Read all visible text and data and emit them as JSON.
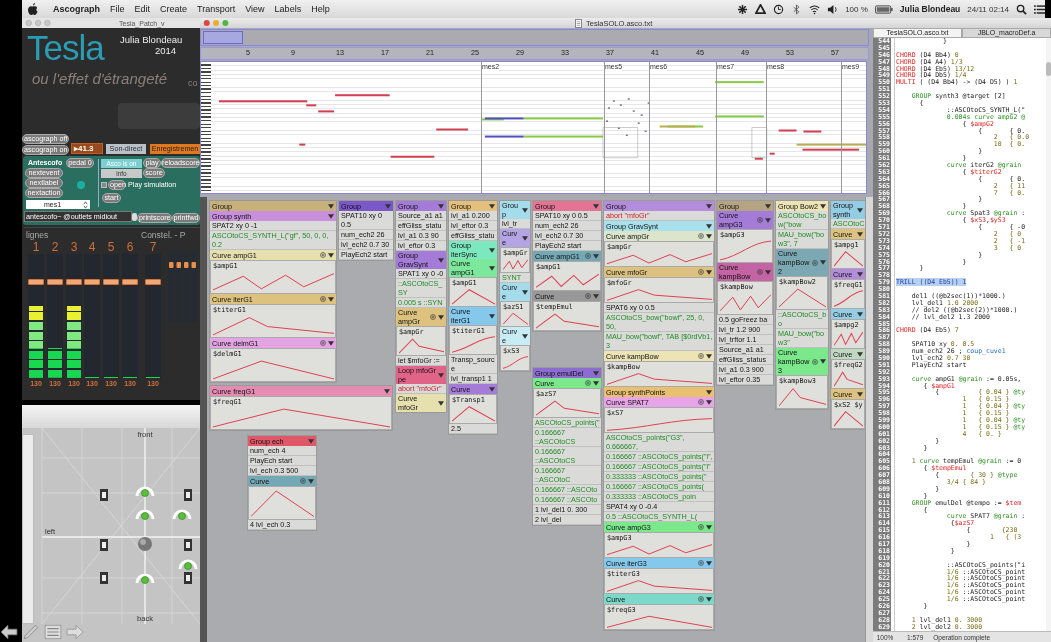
{
  "menu_bar": {
    "app": "Ascograph",
    "items": [
      "File",
      "Edit",
      "Create",
      "Transport",
      "View",
      "Labels",
      "Help"
    ],
    "battery": "100 %",
    "user": "Julia Blondeau",
    "clock": "24/11 02:14"
  },
  "patch": {
    "title": "Tesla_Patch_v",
    "author": "Julia Blondeau",
    "year": "2014",
    "heading": "Tesla",
    "subtitle": "ou l'effet d'étrangeté",
    "cut_text": "co",
    "graph_toggles": [
      "ascograph off",
      "ascograph on"
    ],
    "number_box": "▸41.3",
    "modes": [
      {
        "label": "Son-direct",
        "selected": false
      },
      {
        "label": "Enregistremen",
        "selected": true
      }
    ],
    "antescofo": {
      "title": "Antescofo",
      "pedal": "pedal 0",
      "messages": [
        "nextevent",
        "nextlabel",
        "nextaction"
      ],
      "status": "Asco is on",
      "info": "info",
      "play": "play",
      "score": "score",
      "reload": "reloadscore",
      "sim_toggle": {
        "checked": false
      },
      "open": "open",
      "simulation": "Play simulation",
      "start": "start",
      "menu": "mes1",
      "object": "antescofo~ @outlets midiout",
      "printscore": "printscore",
      "printfwd": "printfwd"
    },
    "mixer": {
      "title": "lignes",
      "right_title": "Constel. - P",
      "channels": [
        {
          "name": "1",
          "meter": {
            "level": 0.58
          },
          "fader": {
            "level": 0.8
          },
          "value": "130"
        },
        {
          "name": "2",
          "meter": {
            "level": 0.24
          },
          "fader": {
            "level": 0.8
          },
          "value": "130"
        },
        {
          "name": "3",
          "meter": {
            "level": 0.58
          },
          "fader": {
            "level": 0.8
          },
          "value": "130"
        },
        {
          "name": "4",
          "meter": {
            "level": 0
          },
          "fader": {
            "level": 0.8
          },
          "value": "130"
        },
        {
          "name": "5",
          "meter": {
            "level": 0
          },
          "fader": {
            "level": 0.8
          },
          "value": "130"
        },
        {
          "name": "6",
          "meter": {
            "level": 0
          },
          "fader": {
            "level": 0.8
          },
          "value": "130"
        },
        {
          "name": "7",
          "meter": {
            "level": 0
          },
          "fader": {
            "level": 0.8
          },
          "value": "130"
        }
      ]
    }
  },
  "spatial": {
    "front": "front",
    "left": "left",
    "back": "back"
  },
  "ascograph": {
    "title": "TeslaSOLO.asco.txt",
    "ruler": [
      "5",
      "9",
      "13",
      "17",
      "21",
      "25",
      "29",
      "33",
      "37",
      "41",
      "45",
      "49",
      "53",
      "57"
    ],
    "measures": [
      "mes2",
      "mes5",
      "mes6",
      "mes7",
      "mes8",
      "mes9"
    ],
    "nodes": [
      {
        "title": "Group",
        "color": "#c8b07a",
        "items": [
          {
            "kind": "header",
            "label": "Group synth",
            "color": "#c890dc"
          },
          {
            "kind": "row",
            "text": "SPAT2 xy 0 -1"
          },
          {
            "kind": "code",
            "text": "ASCOtoCS_SYNTH_L(\"gf\", 50, 0, 0, 0.2"
          },
          {
            "kind": "curve",
            "label": "Curve ampG1",
            "color": "#e6dfae",
            "var": "$ampG1"
          },
          {
            "kind": "curve",
            "label": "Curve iterG1",
            "color": "#dcc27e",
            "var": "$titerG1"
          },
          {
            "kind": "curve",
            "label": "Curve delmG1",
            "color": "#e4a4e4",
            "var": "$delmG1"
          }
        ]
      },
      {
        "title": "Curve freqG1",
        "color": "#e48cb4",
        "items": [
          {
            "kind": "plot",
            "var": "$freqG1"
          }
        ]
      },
      {
        "title": "Group ech",
        "color": "#e05868",
        "items": [
          {
            "kind": "row",
            "text": "num_ech 4"
          },
          {
            "kind": "row",
            "text": "PlayEch start"
          },
          {
            "kind": "row",
            "text": "lvl_ech 0.3 500"
          },
          {
            "kind": "curve",
            "label": "Curve",
            "color": "#74a8b4"
          },
          {
            "kind": "row",
            "text": "4 lvl_ech 0.3"
          }
        ]
      },
      {
        "title": "Group",
        "color": "#7a58c8",
        "items": [
          {
            "kind": "row",
            "text": "SPAT10 xy 0 0.5"
          },
          {
            "kind": "row",
            "text": "num_ech2 26"
          },
          {
            "kind": "row",
            "text": "lvl_ech2 0.7 30"
          },
          {
            "kind": "row",
            "text": "PlayEch2 start"
          }
        ]
      },
      {
        "title": "Group",
        "color": "#a47cd8",
        "items": [
          {
            "kind": "row",
            "text": "Source_a1 a1"
          },
          {
            "kind": "row",
            "text": "effGliss_statu"
          },
          {
            "kind": "row",
            "text": "lvl_a1 0.3 90"
          },
          {
            "kind": "row",
            "text": "lvl_eftor 0.3"
          },
          {
            "kind": "header",
            "label": "Group GravSynt",
            "color": "#a47cd8"
          },
          {
            "kind": "row",
            "text": "SPAT1 xy 0 -0"
          },
          {
            "kind": "code",
            "text": "::ASCOtoCS_SY"
          },
          {
            "kind": "code",
            "text": "0.005 s ::SYN"
          },
          {
            "kind": "curve",
            "label": "Curve ampGr",
            "color": "#dcc27e",
            "var": "$ampGr"
          },
          {
            "kind": "row",
            "text": "let $mfoGr :="
          },
          {
            "kind": "header",
            "label": "Loop mfoGr pe",
            "color": "#e06488"
          },
          {
            "kind": "abort",
            "text": "abort \"mfoGr\""
          },
          {
            "kind": "header",
            "label": "Curve mfoGr",
            "color": "#e6dfae"
          }
        ]
      },
      {
        "title": "Group",
        "color": "#e4c07c",
        "items": [
          {
            "kind": "row",
            "text": "lvl_a1 0.200"
          },
          {
            "kind": "row",
            "text": "lvl_eftor 0.3"
          },
          {
            "kind": "row",
            "text": "effGliss_statu"
          },
          {
            "kind": "header",
            "label": "Group iterSync",
            "color": "#7ce8c0"
          },
          {
            "kind": "curve",
            "label": "Curve ampG1",
            "color": "#7ce89c",
            "var": "$ampG1"
          },
          {
            "kind": "curve",
            "label": "Curve iterG1",
            "color": "#84c8ec",
            "var": "$titerG1"
          },
          {
            "kind": "row",
            "text": "Transp_source"
          },
          {
            "kind": "row",
            "text": "lvl_transp1 1"
          },
          {
            "kind": "curve",
            "label": "Curve",
            "color": "#a47cd8",
            "var": "$Transp1"
          },
          {
            "kind": "row",
            "text": "2.5"
          }
        ]
      },
      {
        "title": "Group",
        "color": "#a4dcec",
        "items": [
          {
            "kind": "row",
            "text": "lvl_tr"
          },
          {
            "kind": "curve",
            "label": "Curve",
            "color": "#b4a4e4",
            "var": "$ampGr"
          },
          {
            "kind": "code",
            "text": "SYNT"
          },
          {
            "kind": "curve",
            "label": "Curve",
            "color": "#a4dcec",
            "var": "$azS1"
          },
          {
            "kind": "curve",
            "label": "Curve",
            "color": "#c8ecf4",
            "var": "$xS3"
          }
        ]
      },
      {
        "title": "Group",
        "color": "#e47494",
        "items": [
          {
            "kind": "row",
            "text": "SPAT10 xy 0 0.5"
          },
          {
            "kind": "row",
            "text": "num_ech2 26"
          },
          {
            "kind": "row",
            "text": "lvl_ech2 0.7 30"
          },
          {
            "kind": "row",
            "text": "PlayEch2 start"
          },
          {
            "kind": "curve",
            "label": "Curve ampG1",
            "color": "#74a8b4",
            "var": "$ampG1"
          },
          {
            "kind": "curve",
            "label": "Curve",
            "color": "#989898",
            "var": "$tempEmul"
          }
        ]
      },
      {
        "title": "Group emulDel",
        "color": "#8c6cd0",
        "items": [
          {
            "kind": "curve",
            "label": "Curve",
            "color": "#7ce88c",
            "var": "$azS7"
          },
          {
            "kind": "code",
            "text": "ASCOtoCS_points(\""
          },
          {
            "kind": "code",
            "text": "0.166667 ::ASCOtoCS"
          },
          {
            "kind": "code",
            "text": "0.166667 ::ASCOtoCS"
          },
          {
            "kind": "code",
            "text": "0.166667 ::ASCOtoC"
          },
          {
            "kind": "code",
            "text": "0.166667 ::ASCOto"
          },
          {
            "kind": "code",
            "text": "0.166667 ::ASCOto"
          },
          {
            "kind": "row",
            "text": "1 lvl_del1 0. 300"
          },
          {
            "kind": "row",
            "text": "2 lvl_del"
          }
        ]
      },
      {
        "title": "Group",
        "color": "#b48cdc",
        "items": [
          {
            "kind": "abort",
            "text": "abort \"mfoGr\""
          },
          {
            "kind": "header",
            "label": "Group GravSynt",
            "color": "#a8e0ec"
          },
          {
            "kind": "curve",
            "label": "Curve ampGr",
            "color": "#dce4cc",
            "var": "$ampGr"
          },
          {
            "kind": "curve",
            "label": "Curve mfoGr",
            "color": "#dcc27e",
            "var": "$mfoGr"
          },
          {
            "kind": "row",
            "text": "SPAT6 xy 0 0.5"
          },
          {
            "kind": "code",
            "text": "ASCOtoCS_bow(\"bowf\", 25, 0, 50,"
          },
          {
            "kind": "code",
            "text": "MAU_bow(\"bowf\", TAB [$0rdVb1, 3"
          },
          {
            "kind": "curve",
            "label": "Curve kampBow",
            "color": "#ece4b4",
            "var": "$kampBow"
          },
          {
            "kind": "header",
            "label": "Group synthPoints",
            "color": "#e8c070"
          },
          {
            "kind": "curve",
            "label": "Curve SPAT7",
            "color": "#e8a4e8",
            "var": "$xS7"
          },
          {
            "kind": "code",
            "text": "ASCOtoCS_points(\"G3\", 0.666667,"
          },
          {
            "kind": "code",
            "text": "0.166667 ::ASCOtoCS_points(\"i\","
          },
          {
            "kind": "code",
            "text": "0.166667 ::ASCOtoCS_points(\"i\""
          },
          {
            "kind": "code",
            "text": "0.333333 ::ASCOtoCS_points(\""
          },
          {
            "kind": "code",
            "text": "0.166667 ::ASCOtoCS_points("
          },
          {
            "kind": "code",
            "text": "0.333333 ::ASCOtoCS_poin"
          },
          {
            "kind": "row",
            "text": "SPAT4 xy 0 -0.4"
          },
          {
            "kind": "code",
            "text": "0.5 ::ASCOtoCS_SYNTH_L("
          },
          {
            "kind": "curve",
            "label": "Curve ampG3",
            "color": "#7ce88c",
            "var": "$ampG3"
          },
          {
            "kind": "curve",
            "label": "Curve iterG3",
            "color": "#84c8ec",
            "var": "$titerG3"
          },
          {
            "kind": "curve",
            "label": "Curve",
            "color": "#7cd8c8",
            "var": "$freqG3"
          }
        ]
      },
      {
        "title": "Group",
        "color": "#b4a484",
        "items": [
          {
            "kind": "curve",
            "label": "Curve ampG3",
            "color": "#a47cd8",
            "var": "$ampG3"
          },
          {
            "kind": "curve",
            "label": "Curve kampBow",
            "color": "#c464a4",
            "var": "$kampBow"
          },
          {
            "kind": "row",
            "text": "0.5 goFreez ba"
          },
          {
            "kind": "row",
            "text": "lvl_tr 1.2 900"
          },
          {
            "kind": "row",
            "text": "lvl_trftor 1.1"
          },
          {
            "kind": "row",
            "text": "Source_a1 a1"
          },
          {
            "kind": "row",
            "text": "effGliss_status"
          },
          {
            "kind": "row",
            "text": "lvl_a1 0.3 900"
          },
          {
            "kind": "row",
            "text": "lvl_eftor 0.35"
          }
        ]
      },
      {
        "title": "Group Bow2",
        "color": "#ece4b4",
        "items": [
          {
            "kind": "code",
            "text": "ASCOtoCS_bow(\"bow"
          },
          {
            "kind": "code",
            "text": "MAU_bow(\"bow3\", 7"
          },
          {
            "kind": "curve",
            "label": "Curve kampBow2",
            "color": "#7ca8b4",
            "var": "$kampBow2"
          },
          {
            "kind": "code",
            "text": "::ASCOtoCS_bo"
          },
          {
            "kind": "code",
            "text": "MAU_bow(\"bow3\""
          },
          {
            "kind": "curve",
            "label": "Curve kampBow3",
            "color": "#7ce88c",
            "var": "$kampBow3"
          }
        ]
      },
      {
        "title": "Group synth",
        "color": "#94cce4",
        "items": [
          {
            "kind": "code",
            "text": "ASCOtoC"
          },
          {
            "kind": "curve",
            "label": "Curve",
            "color": "#dcc27e",
            "var": "$ampg1"
          },
          {
            "kind": "curve",
            "label": "Curve",
            "color": "#b48cdc",
            "var": "$freqG1"
          },
          {
            "kind": "curve",
            "label": "Curve",
            "color": "#94cce4",
            "var": "$ampg2"
          },
          {
            "kind": "curve",
            "label": "Curve",
            "color": "#c0d8c0",
            "var": "$freqG2"
          },
          {
            "kind": "curve",
            "label": "Curve",
            "color": "#dcc27e",
            "var": "$xS2 $y"
          }
        ]
      }
    ]
  },
  "editor": {
    "tabs": [
      {
        "label": "TeslaSOLO.asco.txt",
        "selected": true
      },
      {
        "label": "JBLO_macroDef.a",
        "selected": false
      }
    ],
    "lines": [
      {
        "n": "544",
        "p": [
          {
            "kind": "t",
            "text": "            }"
          }
        ]
      },
      {
        "n": "545"
      },
      {
        "n": "546",
        "p": [
          {
            "kind": "kw",
            "text": "CHORD"
          },
          {
            "kind": "t",
            "text": " (D4 Bb4) "
          },
          {
            "kind": "num",
            "text": "0"
          }
        ]
      },
      {
        "n": "547",
        "p": [
          {
            "kind": "kw",
            "text": "CHORD"
          },
          {
            "kind": "t",
            "text": " (D4 A4) "
          },
          {
            "kind": "num",
            "text": "1/3"
          }
        ]
      },
      {
        "n": "548",
        "p": [
          {
            "kind": "kw",
            "text": "CHORD"
          },
          {
            "kind": "t",
            "text": " (D4 Eb5) "
          },
          {
            "kind": "num",
            "text": "13/12"
          }
        ]
      },
      {
        "n": "549",
        "p": [
          {
            "kind": "kw",
            "text": "CHORD"
          },
          {
            "kind": "t",
            "text": " (D4 Db5) "
          },
          {
            "kind": "num",
            "text": "1/4"
          }
        ]
      },
      {
        "n": "550",
        "p": [
          {
            "kind": "kw",
            "text": "MULTI"
          },
          {
            "kind": "t",
            "text": " ( (D4 Bb4) -> (D4 D5) ) "
          },
          {
            "kind": "num",
            "text": "1"
          }
        ]
      },
      {
        "n": "551"
      },
      {
        "n": "552",
        "p": [
          {
            "kind": "grp",
            "text": "    GROUP"
          },
          {
            "kind": "t",
            "text": " synth3 @target [2]"
          }
        ]
      },
      {
        "n": "553",
        "p": [
          {
            "kind": "t",
            "text": "      {"
          }
        ]
      },
      {
        "n": "554",
        "p": [
          {
            "kind": "t",
            "text": "             ::ASCOtoCS_SYNTH_L(\""
          }
        ]
      },
      {
        "n": "555",
        "p": [
          {
            "kind": "grp",
            "text": "             0.004s curve ampG2 @"
          }
        ]
      },
      {
        "n": "556",
        "p": [
          {
            "kind": "t",
            "text": "                 { "
          },
          {
            "kind": "kw",
            "text": "$ampG2"
          }
        ]
      },
      {
        "n": "557",
        "p": [
          {
            "kind": "t",
            "text": "                     {       { 0."
          }
        ]
      },
      {
        "n": "558",
        "p": [
          {
            "kind": "num",
            "text": "                         2   { 0.0"
          }
        ]
      },
      {
        "n": "559",
        "p": [
          {
            "kind": "num",
            "text": "                         10  { 0."
          }
        ]
      },
      {
        "n": "560",
        "p": [
          {
            "kind": "t",
            "text": "                     }"
          }
        ]
      },
      {
        "n": "561",
        "p": [
          {
            "kind": "t",
            "text": "                 }"
          }
        ]
      },
      {
        "n": "562",
        "p": [
          {
            "kind": "grp",
            "text": "             curve"
          },
          {
            "kind": "t",
            "text": " iterG2 "
          },
          {
            "kind": "grp",
            "text": "@grain"
          }
        ]
      },
      {
        "n": "563",
        "p": [
          {
            "kind": "t",
            "text": "                 { "
          },
          {
            "kind": "kw",
            "text": "$titerG2"
          }
        ]
      },
      {
        "n": "564",
        "p": [
          {
            "kind": "t",
            "text": "                     {       { 0."
          }
        ]
      },
      {
        "n": "565",
        "p": [
          {
            "kind": "num",
            "text": "                         2   { 11"
          }
        ]
      },
      {
        "n": "566",
        "p": [
          {
            "kind": "num",
            "text": "                         7   { 0."
          }
        ]
      },
      {
        "n": "567",
        "p": [
          {
            "kind": "t",
            "text": "                     }"
          }
        ]
      },
      {
        "n": "568",
        "p": [
          {
            "kind": "t",
            "text": "                 }"
          }
        ]
      },
      {
        "n": "569",
        "p": [
          {
            "kind": "grp",
            "text": "             curve"
          },
          {
            "kind": "t",
            "text": " Spat3 "
          },
          {
            "kind": "grp",
            "text": "@grain"
          },
          {
            "kind": "t",
            "text": " :"
          }
        ]
      },
      {
        "n": "570",
        "p": [
          {
            "kind": "t",
            "text": "                 { "
          },
          {
            "kind": "kw",
            "text": "$xS3"
          },
          {
            "kind": "t",
            "text": ","
          },
          {
            "kind": "kw",
            "text": "$yS3"
          }
        ]
      },
      {
        "n": "571",
        "p": [
          {
            "kind": "t",
            "text": "                     {       { -0"
          }
        ]
      },
      {
        "n": "572",
        "p": [
          {
            "kind": "num",
            "text": "                         2   { 0"
          }
        ]
      },
      {
        "n": "573",
        "p": [
          {
            "kind": "num",
            "text": "                         2   { -1"
          }
        ]
      },
      {
        "n": "574",
        "p": [
          {
            "kind": "num",
            "text": "                         3   { 0"
          }
        ]
      },
      {
        "n": "575",
        "p": [
          {
            "kind": "t",
            "text": "                     }"
          }
        ]
      },
      {
        "n": "576",
        "p": [
          {
            "kind": "t",
            "text": "                 }"
          }
        ]
      },
      {
        "n": "577",
        "p": [
          {
            "kind": "t",
            "text": "      }"
          }
        ]
      },
      {
        "n": "578"
      },
      {
        "n": "579",
        "p": [
          {
            "kind": "hl",
            "text": "TRILL ((D4 Eb5)) 1"
          }
        ]
      },
      {
        "n": "580"
      },
      {
        "n": "581",
        "p": [
          {
            "kind": "t",
            "text": "    del1 ((@b2sec(1))*1000.)"
          }
        ]
      },
      {
        "n": "582",
        "p": [
          {
            "kind": "t",
            "text": "    lvl_del1 "
          },
          {
            "kind": "num",
            "text": "1.0 2000"
          }
        ]
      },
      {
        "n": "583",
        "p": [
          {
            "kind": "t",
            "text": "    // del2 ((@b2sec(2))*1000.)"
          }
        ]
      },
      {
        "n": "584",
        "p": [
          {
            "kind": "t",
            "text": "    // lvl_del2 1.3 2000"
          }
        ]
      },
      {
        "n": "585"
      },
      {
        "n": "586",
        "p": [
          {
            "kind": "kw",
            "text": "CHORD"
          },
          {
            "kind": "t",
            "text": " (D4 Eb5) "
          },
          {
            "kind": "num",
            "text": "7"
          }
        ]
      },
      {
        "n": "587"
      },
      {
        "n": "588",
        "p": [
          {
            "kind": "t",
            "text": "    SPAT10 xy "
          },
          {
            "kind": "num",
            "text": "0. 0.5"
          }
        ]
      },
      {
        "n": "589",
        "p": [
          {
            "kind": "t",
            "text": "    num_ech2 26 ; "
          },
          {
            "kind": "link",
            "text": "coup_cuve1"
          }
        ]
      },
      {
        "n": "590",
        "p": [
          {
            "kind": "t",
            "text": "    lvl_ech2 "
          },
          {
            "kind": "num",
            "text": "0.7 30"
          }
        ]
      },
      {
        "n": "591",
        "p": [
          {
            "kind": "t",
            "text": "    PlayEch2 start"
          }
        ]
      },
      {
        "n": "592"
      },
      {
        "n": "593",
        "p": [
          {
            "kind": "grp",
            "text": "    curve"
          },
          {
            "kind": "t",
            "text": " ampG1 "
          },
          {
            "kind": "grp",
            "text": "@grain"
          },
          {
            "kind": "t",
            "text": " := 0.05s,"
          }
        ]
      },
      {
        "n": "594",
        "p": [
          {
            "kind": "t",
            "text": "       { "
          },
          {
            "kind": "kw",
            "text": "$ampG1"
          }
        ]
      },
      {
        "n": "595",
        "p": [
          {
            "kind": "t",
            "text": "          {          "
          },
          {
            "kind": "num",
            "text": "{ 0.04 }"
          },
          {
            "kind": "grp",
            "text": " @ty"
          }
        ]
      },
      {
        "n": "596",
        "p": [
          {
            "kind": "num",
            "text": "                 1   { 0.15 }"
          }
        ]
      },
      {
        "n": "597",
        "p": [
          {
            "kind": "num",
            "text": "                 1   { 0.04 }"
          },
          {
            "kind": "grp",
            "text": " @ty"
          }
        ]
      },
      {
        "n": "598",
        "p": [
          {
            "kind": "num",
            "text": "                 1   { 0.15 }"
          }
        ]
      },
      {
        "n": "599",
        "p": [
          {
            "kind": "num",
            "text": "                 1   { 0.04 }"
          },
          {
            "kind": "grp",
            "text": " @ty"
          }
        ]
      },
      {
        "n": "600",
        "p": [
          {
            "kind": "num",
            "text": "                 1   { 0.15 }"
          },
          {
            "kind": "grp",
            "text": " @ty"
          }
        ]
      },
      {
        "n": "601",
        "p": [
          {
            "kind": "num",
            "text": "                 4   { 0. }"
          }
        ]
      },
      {
        "n": "602",
        "p": [
          {
            "kind": "t",
            "text": "          }"
          }
        ]
      },
      {
        "n": "603",
        "p": [
          {
            "kind": "t",
            "text": "       }"
          }
        ]
      },
      {
        "n": "604"
      },
      {
        "n": "605",
        "p": [
          {
            "kind": "num",
            "text": "    1 "
          },
          {
            "kind": "grp",
            "text": "curve"
          },
          {
            "kind": "t",
            "text": " tempEmul "
          },
          {
            "kind": "grp",
            "text": "@grain"
          },
          {
            "kind": "t",
            "text": " := 0"
          }
        ]
      },
      {
        "n": "606",
        "p": [
          {
            "kind": "t",
            "text": "       { "
          },
          {
            "kind": "kw",
            "text": "$tempEmul"
          }
        ]
      },
      {
        "n": "607",
        "p": [
          {
            "kind": "t",
            "text": "          {        "
          },
          {
            "kind": "num",
            "text": "{ 30 }"
          },
          {
            "kind": "grp",
            "text": " @type"
          }
        ]
      },
      {
        "n": "608",
        "p": [
          {
            "kind": "num",
            "text": "             3/4 { 84 }"
          }
        ]
      },
      {
        "n": "609",
        "p": [
          {
            "kind": "t",
            "text": "          }"
          }
        ]
      },
      {
        "n": "610",
        "p": [
          {
            "kind": "t",
            "text": "       }"
          }
        ]
      },
      {
        "n": "611",
        "p": [
          {
            "kind": "grp",
            "text": "    GROUP"
          },
          {
            "kind": "t",
            "text": " emulDel @tempo := "
          },
          {
            "kind": "kw",
            "text": "$tem"
          }
        ]
      },
      {
        "n": "612",
        "p": [
          {
            "kind": "t",
            "text": "       {"
          }
        ]
      },
      {
        "n": "613",
        "p": [
          {
            "kind": "grp",
            "text": "             curve"
          },
          {
            "kind": "t",
            "text": " SPAT7 "
          },
          {
            "kind": "grp",
            "text": "@grain"
          },
          {
            "kind": "t",
            "text": " :"
          }
        ]
      },
      {
        "n": "614",
        "p": [
          {
            "kind": "t",
            "text": "              {"
          },
          {
            "kind": "kw",
            "text": "$azS7"
          }
        ]
      },
      {
        "n": "615",
        "p": [
          {
            "kind": "t",
            "text": "                  {        "
          },
          {
            "kind": "num",
            "text": "{230"
          }
        ]
      },
      {
        "n": "616",
        "p": [
          {
            "kind": "num",
            "text": "                        1   { (3"
          }
        ]
      },
      {
        "n": "617",
        "p": [
          {
            "kind": "t",
            "text": "                  }"
          }
        ]
      },
      {
        "n": "618",
        "p": [
          {
            "kind": "t",
            "text": "              }"
          }
        ]
      },
      {
        "n": "619"
      },
      {
        "n": "620",
        "p": [
          {
            "kind": "t",
            "text": "             ::ASCOtoCS_points(\"i"
          }
        ]
      },
      {
        "n": "621",
        "p": [
          {
            "kind": "num",
            "text": "             1/6"
          },
          {
            "kind": "t",
            "text": " ::ASCOtoCS_point"
          }
        ]
      },
      {
        "n": "622",
        "p": [
          {
            "kind": "num",
            "text": "             1/6"
          },
          {
            "kind": "t",
            "text": " ::ASCOtoCS_point"
          }
        ]
      },
      {
        "n": "623",
        "p": [
          {
            "kind": "num",
            "text": "             1/6"
          },
          {
            "kind": "t",
            "text": " ::ASCOtoCS_point"
          }
        ]
      },
      {
        "n": "624",
        "p": [
          {
            "kind": "num",
            "text": "             1/6"
          },
          {
            "kind": "t",
            "text": " ::ASCOtoCS_point"
          }
        ]
      },
      {
        "n": "625",
        "p": [
          {
            "kind": "num",
            "text": "             1/6"
          },
          {
            "kind": "t",
            "text": " ::ASCOtoCS_point"
          }
        ]
      },
      {
        "n": "626",
        "p": [
          {
            "kind": "t",
            "text": "       }"
          }
        ]
      },
      {
        "n": "627"
      },
      {
        "n": "628",
        "p": [
          {
            "kind": "num",
            "text": "    1"
          },
          {
            "kind": "t",
            "text": " lvl_del1 "
          },
          {
            "kind": "num",
            "text": "0. 3000"
          }
        ]
      },
      {
        "n": "629",
        "p": [
          {
            "kind": "num",
            "text": "    2"
          },
          {
            "kind": "t",
            "text": " lvl_del2 "
          },
          {
            "kind": "num",
            "text": "0. 3000"
          }
        ]
      }
    ],
    "status": {
      "zoom": "100%",
      "position": "1:579",
      "message": "Operation complete"
    }
  }
}
